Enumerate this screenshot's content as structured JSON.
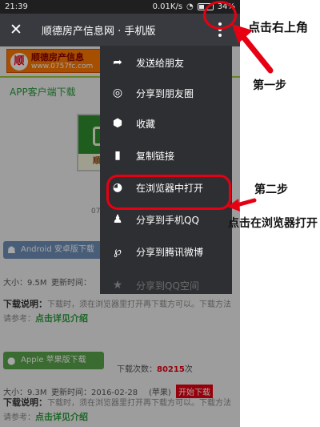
{
  "status_bar": {
    "time": "21:39",
    "speed": "0.01K/s",
    "battery": "34%"
  },
  "browser_bar": {
    "title": "顺德房产信息网 · 手机版"
  },
  "page": {
    "banner_name": "顺德房产信息",
    "banner_url": "www.0757fc.com",
    "app_download_link": "APP客户端下载",
    "app_icon_text": "顺德",
    "version_fragment": "07",
    "android_button": "Android 安卓版下载",
    "android_size": "大小：9.5M",
    "android_time": "更新时间：",
    "note_label": "下载说明：",
    "note_text": "下载时，须在浏览器里打开再下载方可以。下载方法请参考：",
    "note_link": "点击详见介绍",
    "apple_button": "Apple 苹果版下载",
    "apple_count_label": "下载次数：",
    "apple_count": "80215",
    "apple_count_unit": "次",
    "apple_size": "大小：9.3M",
    "apple_time": "更新时间：2016-02-28",
    "apple_platform": "(苹果)",
    "apple_start": "开始下载"
  },
  "menu": {
    "items": [
      {
        "icon": "share-icon",
        "label": "发送给朋友"
      },
      {
        "icon": "moments-icon",
        "label": "分享到朋友圈"
      },
      {
        "icon": "favorite-icon",
        "label": "收藏"
      },
      {
        "icon": "copy-link-icon",
        "label": "复制链接"
      },
      {
        "icon": "browser-icon",
        "label": "在浏览器中打开"
      },
      {
        "icon": "qq-icon",
        "label": "分享到手机QQ"
      },
      {
        "icon": "weibo-icon",
        "label": "分享到腾讯微博"
      },
      {
        "icon": "qzone-icon",
        "label": "分享到QQ空间"
      }
    ]
  },
  "annotations": {
    "click_top_right": "点击右上角",
    "step_one": "第一步",
    "step_two": "第二步",
    "click_browser_open": "点击在浏览器打开"
  },
  "colors": {
    "highlight": "#e60012",
    "menu_bg": "#2e2f33",
    "toolbar_bg": "#393a3f",
    "link_green": "#2a9d3a"
  }
}
